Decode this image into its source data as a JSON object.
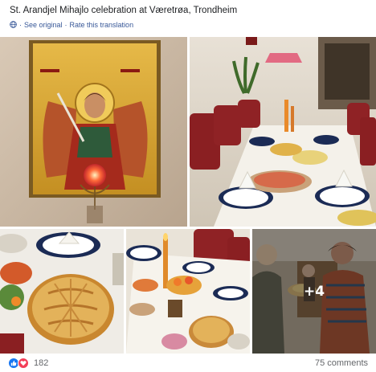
{
  "post": {
    "text": "St. Arandjel Mihajlo celebration at Væretrøa, Trondheim",
    "see_original": "See original",
    "separator": "·",
    "rate_translation": "Rate this translation"
  },
  "photos": {
    "more_label": "+4"
  },
  "footer": {
    "reaction_count": "182",
    "comments": "75 comments"
  },
  "icons": {
    "globe": "globe-icon",
    "like": "like-reaction-icon",
    "love": "love-reaction-icon"
  },
  "colors": {
    "link": "#385898",
    "like": "#1877f2",
    "love": "#f33e58",
    "meta_text": "#65676b"
  }
}
